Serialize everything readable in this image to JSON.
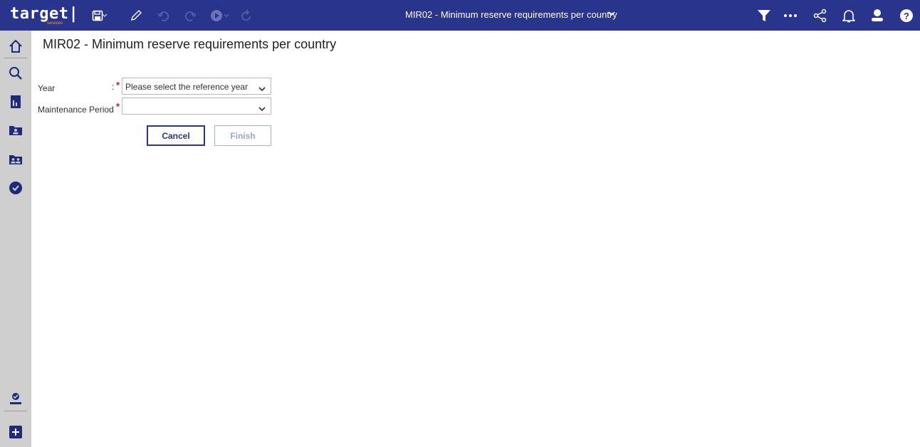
{
  "app": {
    "logo_text": "target|",
    "logo_sub": "services",
    "document_title": "MIR02 - Minimum reserve requirements per country"
  },
  "toolbar": {
    "left_icons": [
      "save-icon",
      "dropdown-arrow-icon",
      "edit-pencil-icon",
      "undo-icon",
      "redo-icon",
      "play-icon",
      "dropdown-arrow-icon",
      "refresh-icon"
    ],
    "right_icons": [
      "filter-icon",
      "more-icon",
      "share-icon",
      "bell-icon",
      "user-icon",
      "help-icon"
    ]
  },
  "sidebar": {
    "items": [
      "home-icon",
      "search-icon",
      "document-icon",
      "folder-user-icon",
      "folder-users-icon",
      "check-circle-icon"
    ],
    "bottom_items": [
      "user-pin-icon",
      "add-icon"
    ]
  },
  "page": {
    "title": "MIR02 - Minimum reserve requirements per country"
  },
  "form": {
    "year": {
      "label": "Year",
      "colon": ":",
      "required_mark": "*",
      "value": "Please select the reference year"
    },
    "maintenance_period": {
      "label": "Maintenance Period",
      "colon": ":",
      "required_mark": "*",
      "value": ""
    },
    "cancel_label": "Cancel",
    "finish_label": "Finish"
  },
  "colors": {
    "header_bg": "#29348c",
    "sidebar_bg": "#cfcfcf",
    "required": "#d9161d",
    "primary": "#29348c"
  }
}
